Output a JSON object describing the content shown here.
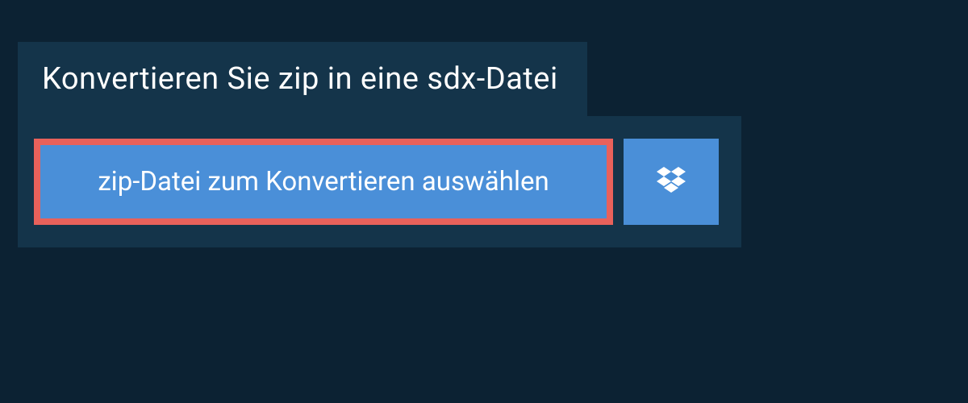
{
  "header": {
    "title": "Konvertieren Sie zip in eine sdx-Datei"
  },
  "actions": {
    "select_file_label": "zip-Datei zum Konvertieren auswählen"
  },
  "colors": {
    "background": "#0c2233",
    "panel": "#14344a",
    "button": "#4a8fd8",
    "highlight_border": "#e8615b"
  }
}
